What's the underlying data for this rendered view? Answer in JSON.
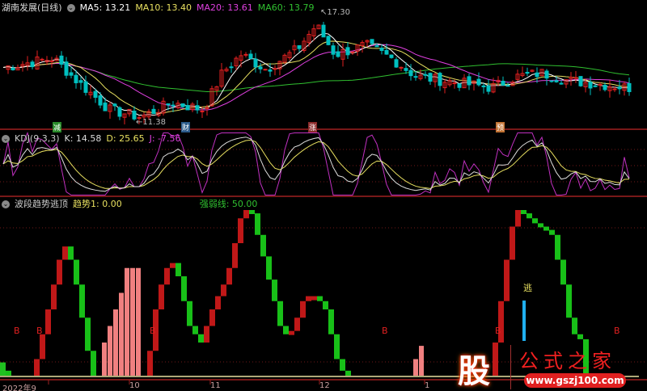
{
  "main": {
    "title": "湖南发展(日线)",
    "ma5": "MA5: 13.21",
    "ma10": "MA10: 13.40",
    "ma20": "MA20: 13.61",
    "ma60": "MA60: 13.79",
    "high_label": "17.30",
    "low_label": "11.38",
    "markers": [
      {
        "text": "减",
        "color": "#2a8a2a"
      },
      {
        "text": "财",
        "color": "#2a5a8a"
      },
      {
        "text": "涨",
        "color": "#8a2a2a"
      },
      {
        "text": "预",
        "color": "#c07030"
      }
    ]
  },
  "kdj": {
    "name": "KDJ(9,3,3)",
    "k": "K: 14.58",
    "d": "D: 25.65",
    "j": "J: -7.56"
  },
  "ind": {
    "name": "波段趋势逃顶",
    "trend": "趋势1: 0.00",
    "strong": "强弱线: 50.00",
    "escape": "逃",
    "b": "B"
  },
  "axis": [
    "2022年9",
    "10",
    "11",
    "12",
    "1"
  ],
  "logo": {
    "char": "股",
    "name": "公式之家",
    "url": "www.gszj100.com"
  },
  "colors": {
    "up": "#e02020",
    "down": "#00c0c0",
    "ma5": "#ffffff",
    "ma10": "#e8e060",
    "ma20": "#e040e0",
    "ma60": "#30c030"
  },
  "chart_data": {
    "type": "candlestick+indicator",
    "price_keypoints": [
      [
        0,
        14.3
      ],
      [
        0.08,
        14.8
      ],
      [
        0.12,
        13.5
      ],
      [
        0.17,
        12.0
      ],
      [
        0.22,
        11.6
      ],
      [
        0.27,
        12.4
      ],
      [
        0.32,
        12.0
      ],
      [
        0.35,
        14.0
      ],
      [
        0.38,
        15.0
      ],
      [
        0.42,
        14.2
      ],
      [
        0.47,
        15.3
      ],
      [
        0.5,
        16.6
      ],
      [
        0.53,
        15.0
      ],
      [
        0.58,
        15.5
      ],
      [
        0.62,
        14.8
      ],
      [
        0.66,
        13.8
      ],
      [
        0.72,
        13.5
      ],
      [
        0.78,
        13.2
      ],
      [
        0.82,
        13.8
      ],
      [
        0.86,
        14.0
      ],
      [
        0.9,
        13.6
      ],
      [
        0.95,
        13.4
      ],
      [
        1,
        13.2
      ]
    ],
    "price_range": [
      11.38,
      17.3
    ],
    "trend": [
      3,
      0,
      0,
      0,
      0,
      0,
      10,
      25,
      40,
      55,
      70,
      78,
      70,
      55,
      35,
      15,
      0,
      0,
      0,
      0,
      0,
      0,
      0,
      0,
      0,
      0,
      15,
      40,
      55,
      65,
      68,
      60,
      45,
      30,
      25,
      20,
      30,
      40,
      48,
      55,
      65,
      80,
      95,
      100,
      98,
      85,
      72,
      58,
      45,
      30,
      25,
      27,
      35,
      45,
      48,
      48,
      45,
      40,
      25,
      10,
      3,
      0,
      0,
      0,
      0,
      0,
      0,
      0,
      0,
      0,
      0,
      0,
      0,
      0,
      0,
      0,
      0,
      0,
      0,
      0,
      0,
      0,
      0,
      0,
      0,
      0,
      0,
      20,
      45,
      70,
      90,
      100,
      98,
      95,
      92,
      90,
      88,
      85,
      70,
      55,
      35,
      25,
      22,
      0,
      0,
      0,
      0,
      0,
      0,
      0,
      0,
      0,
      0
    ],
    "pink": [
      [
        18,
        20
      ],
      [
        19,
        30
      ],
      [
        20,
        40
      ],
      [
        21,
        50
      ],
      [
        22,
        65
      ],
      [
        23,
        65
      ],
      [
        24,
        65
      ],
      [
        73,
        10
      ],
      [
        74,
        18
      ]
    ],
    "strong_line": 50,
    "b_signals": [
      2,
      6,
      26,
      67,
      87,
      108
    ]
  }
}
